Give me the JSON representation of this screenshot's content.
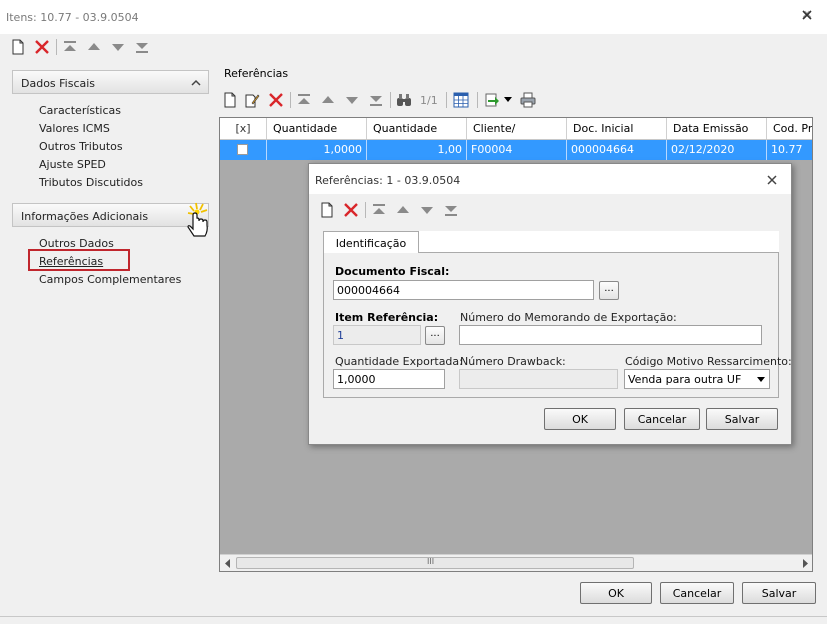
{
  "window": {
    "title": "Itens: 10.77 - 03.9.0504"
  },
  "left_panel": {
    "groups": [
      {
        "title": "Dados Fiscais",
        "items": [
          "Características",
          "Valores ICMS",
          "Outros Tributos",
          "Ajuste SPED",
          "Tributos Discutidos"
        ]
      },
      {
        "title": "Informações Adicionais",
        "items": [
          "Outros Dados",
          "Referências",
          "Campos Complementares"
        ]
      }
    ],
    "selected_item": "Referências"
  },
  "references": {
    "title": "Referências",
    "pager": "1/1",
    "grid": {
      "columns": [
        "[x]",
        "Quantidade",
        "Quantidade",
        "Cliente/",
        "Doc. Inicial",
        "Data Emissão",
        "Cod. Pro"
      ],
      "rows": [
        {
          "checked": false,
          "cells": [
            "1,0000",
            "1,00",
            "F00004",
            "000004664",
            "02/12/2020",
            "10.77"
          ]
        }
      ]
    },
    "scrollbar_glyph": "III"
  },
  "dialog": {
    "title": "Referências: 1 - 03.9.0504",
    "tab": "Identificação",
    "fields": {
      "documento_fiscal": {
        "label": "Documento Fiscal:",
        "value": "000004664"
      },
      "item_referencia": {
        "label": "Item Referência:",
        "value": "1"
      },
      "numero_memorando": {
        "label": "Número do Memorando de Exportação:",
        "value": ""
      },
      "quantidade_exportada": {
        "label": "Quantidade Exportada:",
        "value": "1,0000"
      },
      "numero_drawback": {
        "label": "Número Drawback:",
        "value": ""
      },
      "codigo_motivo": {
        "label": "Código Motivo Ressarcimento:",
        "value": "Venda para outra UF"
      }
    },
    "ellipsis": "...",
    "buttons": {
      "ok": "OK",
      "cancel": "Cancelar",
      "save": "Salvar"
    }
  },
  "footer": {
    "ok": "OK",
    "cancel": "Cancelar",
    "save": "Salvar"
  },
  "colors": {
    "selection": "#3399ff",
    "grid_bg": "#aaaaaa",
    "delete_red": "#d9262a",
    "highlight_box": "#c0262d"
  }
}
